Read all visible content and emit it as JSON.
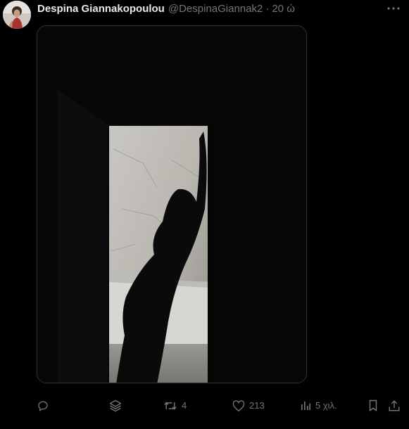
{
  "tweet": {
    "display_name": "Despina Giannakopoulou",
    "handle": "@DespinaGiannak2",
    "separator": "·",
    "time": "20 ώ"
  },
  "actions": {
    "reply_icon": "reply-icon",
    "layers_icon": "layers-icon",
    "retweet_count": "4",
    "like_count": "213",
    "views_count": "5 χιλ.",
    "bookmark_icon": "bookmark-icon",
    "share_icon": "share-icon"
  },
  "colors": {
    "background": "#000000",
    "text_primary": "#e7e9ea",
    "text_secondary": "#71767b",
    "border": "#2f3336"
  }
}
